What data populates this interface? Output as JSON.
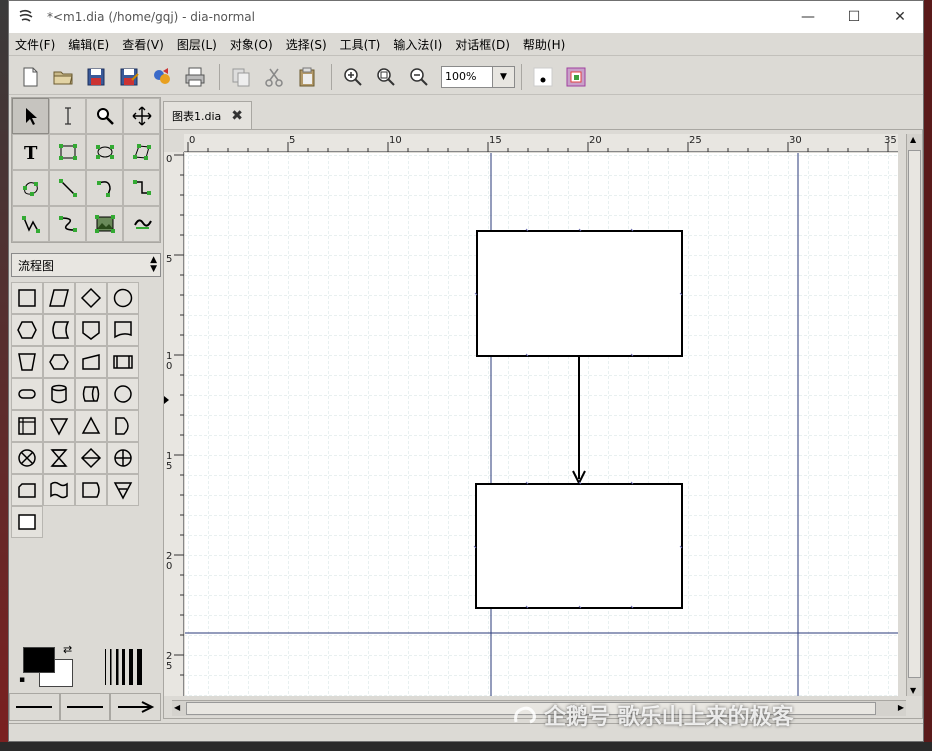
{
  "window": {
    "title": "*<m1.dia (/home/gqj) - dia-normal",
    "minimize_icon": "minimize-icon",
    "maximize_icon": "maximize-icon",
    "close_icon": "close-icon"
  },
  "menu": [
    "文件(F)",
    "编辑(E)",
    "查看(V)",
    "图层(L)",
    "对象(O)",
    "选择(S)",
    "工具(T)",
    "输入法(I)",
    "对话框(D)",
    "帮助(H)"
  ],
  "toolbar": {
    "zoom_value": "100%"
  },
  "sheet": {
    "selected": "流程图"
  },
  "tab": {
    "label": "图表1.dia"
  },
  "ruler": {
    "h_labels": [
      "0",
      "5",
      "10",
      "15",
      "20",
      "25",
      "30",
      "35"
    ],
    "v_labels": [
      "0",
      "5",
      "1\n0",
      "1\n5",
      "2\n0",
      "2\n5"
    ]
  },
  "watermark": {
    "text": "企鹅号 歌乐山上来的极客"
  }
}
